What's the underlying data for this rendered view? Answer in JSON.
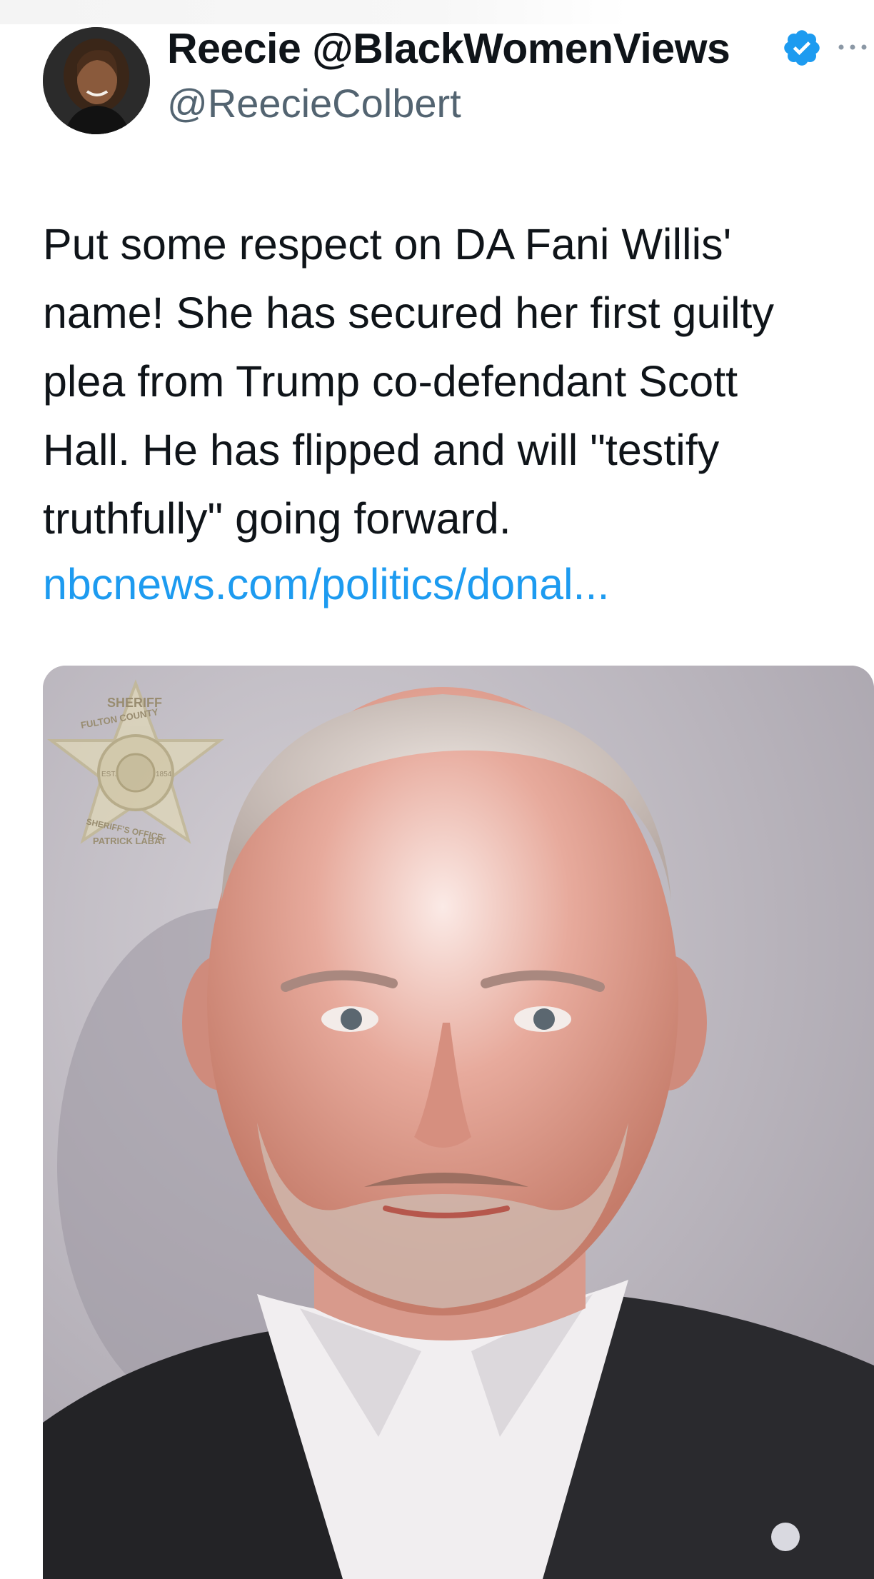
{
  "author": {
    "display_name": "Reecie @BlackWomenViews",
    "handle": "@ReecieColbert",
    "verified": true,
    "avatar_icon": "profile-photo"
  },
  "tweet": {
    "text_lines": [
      "Put some respect on DA Fani Willis'",
      "name! She has secured her first guilty",
      "plea from Trump co-defendant Scott",
      "Hall. He has flipped and will \"testify",
      "truthfully\" going forward."
    ],
    "link_text": "nbcnews.com/politics/donal..."
  },
  "media": {
    "type": "photo",
    "badge_text_lines": [
      "SHERIFF",
      "FULTON COUNTY",
      "EST.",
      "1854",
      "SHERIFF'S OFFICE",
      "PATRICK LABAT"
    ]
  },
  "colors": {
    "link": "#1d9bf0",
    "verified": "#1d9bf0",
    "secondary_text": "#536471"
  },
  "icons": {
    "verified": "verified-badge-icon",
    "more": "more-options-icon"
  }
}
